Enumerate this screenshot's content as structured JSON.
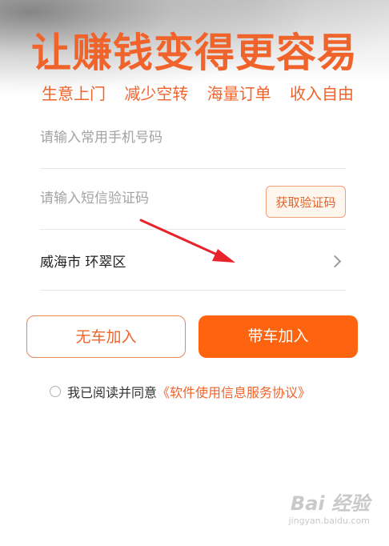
{
  "header": {
    "title": "让赚钱变得更容易",
    "slogans": [
      "生意上门",
      "减少空转",
      "海量订单",
      "收入自由"
    ]
  },
  "form": {
    "phone_placeholder": "请输入常用手机号码",
    "code_placeholder": "请输入短信验证码",
    "get_code_label": "获取验证码",
    "city_value": "威海市 环翠区"
  },
  "actions": {
    "join_without_car_label": "无车加入",
    "join_with_car_label": "带车加入"
  },
  "agreement": {
    "prefix": "我已阅读并同意",
    "link_text": "《软件使用信息服务协议》"
  },
  "watermark": {
    "brand": "Bai 经验",
    "url": "jingyan.baidu.com"
  },
  "colors": {
    "accent": "#f0632b",
    "primary_button": "#fe6410",
    "annotation_arrow": "#e8232a"
  }
}
